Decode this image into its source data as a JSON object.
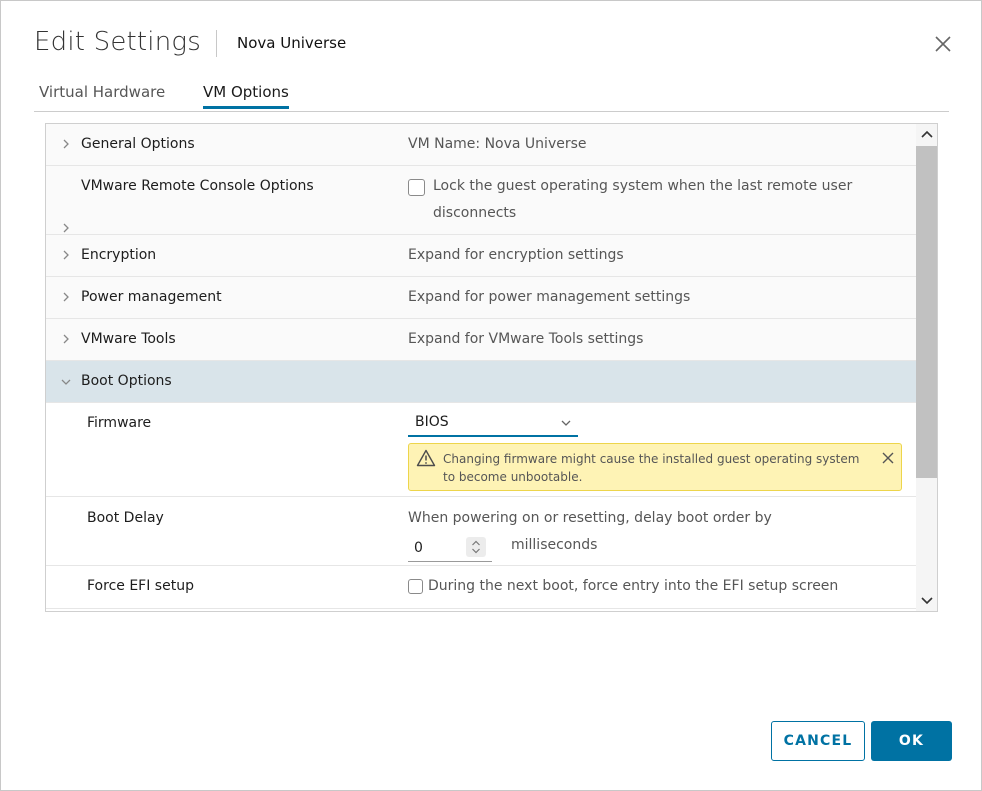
{
  "dialog": {
    "title": "Edit Settings",
    "subtitle": "Nova Universe"
  },
  "tabs": [
    {
      "label": "Virtual Hardware",
      "active": false
    },
    {
      "label": "VM Options",
      "active": true
    }
  ],
  "rows": {
    "general": {
      "label": "General Options",
      "value": "VM Name: Nova Universe"
    },
    "console": {
      "label": "VMware Remote Console Options",
      "checkbox_text_line1": "Lock the guest operating system when the last remote user",
      "checkbox_text_line2": "disconnects",
      "checked": false
    },
    "encryption": {
      "label": "Encryption",
      "value": "Expand for encryption settings"
    },
    "power": {
      "label": "Power management",
      "value": "Expand for power management settings"
    },
    "tools": {
      "label": "VMware Tools",
      "value": "Expand for VMware Tools settings"
    },
    "boot": {
      "label": "Boot Options",
      "expanded": true
    }
  },
  "boot": {
    "firmware": {
      "label": "Firmware",
      "selected": "BIOS",
      "warning_line1": "Changing firmware might cause the installed guest operating system",
      "warning_line2": "to become unbootable."
    },
    "delay": {
      "label": "Boot Delay",
      "description": "When powering on or resetting, delay boot order by",
      "value": "0",
      "unit": "milliseconds"
    },
    "efi": {
      "label": "Force EFI setup",
      "checkbox_text": "During the next boot, force entry into the EFI setup screen",
      "checked": false
    }
  },
  "buttons": {
    "cancel": "CANCEL",
    "ok": "OK"
  },
  "colors": {
    "accent": "#0072a3",
    "expanded_row": "#d9e4ea",
    "warning_bg": "#fef3b5"
  }
}
